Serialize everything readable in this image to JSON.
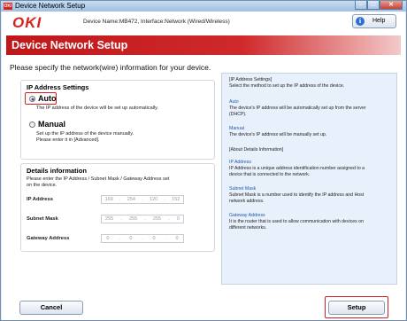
{
  "window": {
    "title": "Device Network Setup",
    "app_icon_text": "OKI",
    "min_glyph": "–",
    "max_glyph": "□",
    "close_glyph": "✕"
  },
  "header": {
    "logo": "OKI",
    "device_info": "Device Name:MB472, Interface:Network (Wired/Wireless)",
    "help_label": "Help",
    "help_icon": "info-icon"
  },
  "banner": {
    "title": "Device Network Setup"
  },
  "instruction": "Please specify the network(wire) information for your device.",
  "ip_settings": {
    "title": "IP Address Settings",
    "auto": {
      "label": "Auto",
      "selected": true,
      "desc": "The IP address of the device will be set up automatically."
    },
    "manual": {
      "label": "Manual",
      "selected": false,
      "desc_line1": "Set up the IP address of the device manually.",
      "desc_line2": "Please enter it in [Advanced]."
    }
  },
  "details": {
    "title": "Details information",
    "desc_line1": "Please enter the IP Address / Subnet Mask / Gateway Address set",
    "desc_line2": "on the device.",
    "ip": {
      "label": "IP Address",
      "o1": "169",
      "o2": "254",
      "o3": "120",
      "o4": "152"
    },
    "subnet": {
      "label": "Subnet Mask",
      "o1": "255",
      "o2": "255",
      "o3": "255",
      "o4": "0"
    },
    "gateway": {
      "label": "Gateway Address",
      "o1": "0",
      "o2": "0",
      "o3": "0",
      "o4": "0"
    }
  },
  "help_panel": {
    "ip_settings_head": "[IP Address Settings]",
    "ip_settings_text": "Select the method to set up the IP address of the device.",
    "auto_head": "Auto",
    "auto_text1": "The device's IP address will be automatically set up from the server",
    "auto_text2": "(DHCP).",
    "manual_head": "Manual",
    "manual_text": "The device's IP address will be manually set up.",
    "details_head": "[About Details Information]",
    "ip_head": "IP Address",
    "ip_text1": "IP Address is a unique address identification number assigned to a",
    "ip_text2": "device that is connected to the network.",
    "subnet_head": "Subnet Mask",
    "subnet_text1": "Subnet Mask is a number used to identify the IP address and Host",
    "subnet_text2": "network address.",
    "gateway_head": "Gateway Address",
    "gateway_text1": "It is the router that is used to allow communication with devices on",
    "gateway_text2": "different networks."
  },
  "footer": {
    "cancel_label": "Cancel",
    "setup_label": "Setup"
  },
  "colors": {
    "brand_red": "#d9221c",
    "highlight_red": "#d81e22",
    "help_panel_bg": "#e8f1fb",
    "link_blue": "#1f5aa8"
  }
}
